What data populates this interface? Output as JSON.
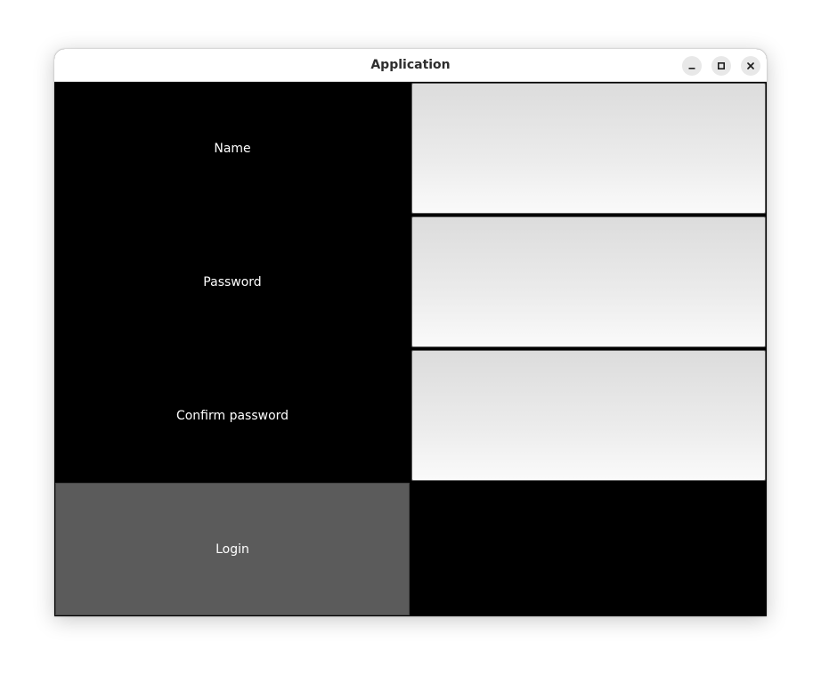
{
  "window": {
    "title": "Application"
  },
  "form": {
    "name_label": "Name",
    "name_value": "",
    "password_label": "Password",
    "password_value": "",
    "confirm_label": "Confirm password",
    "confirm_value": "",
    "login_label": "Login"
  },
  "icons": {
    "minimize": "minimize-icon",
    "maximize": "maximize-icon",
    "close": "close-icon"
  },
  "colors": {
    "background": "#000000",
    "button": "#5b5b5b",
    "label_text": "#ffffff"
  }
}
